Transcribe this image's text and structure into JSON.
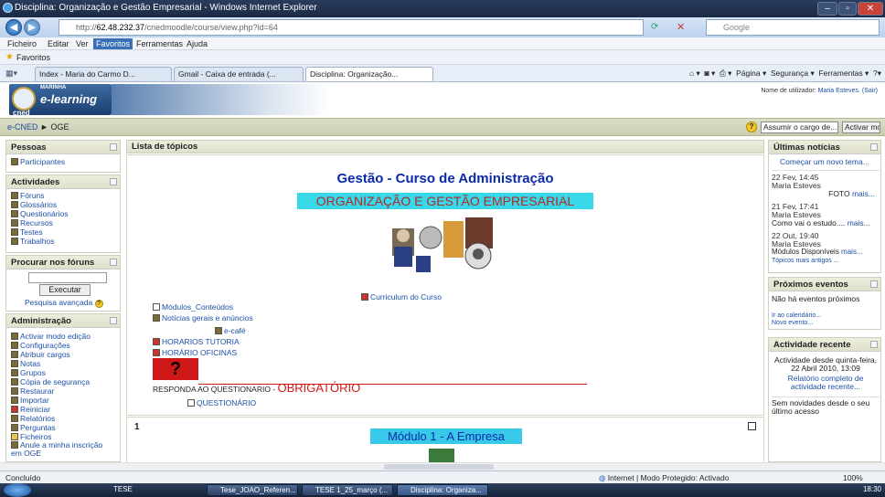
{
  "window": {
    "title": "Disciplina: Organização e Gestão Empresarial - Windows Internet Explorer"
  },
  "address": {
    "url_prefix": "http://",
    "url_host": "62.48.232.37",
    "url_path": "/cnedmoodle/course/view.php?id=64",
    "search_placeholder": "Google"
  },
  "menu": {
    "items": [
      "Ficheiro",
      "Editar",
      "Ver",
      "Favoritos",
      "Ferramentas",
      "Ajuda"
    ]
  },
  "favorites": {
    "label": "Favoritos"
  },
  "tabs": [
    "Index - Maria do Carmo D...",
    "Gmail - Caixa de entrada (...",
    "Disciplina: Organização..."
  ],
  "commandbar": {
    "page": "Página ▾",
    "security": "Segurança ▾",
    "tools": "Ferramentas ▾"
  },
  "header": {
    "logo_top": "MARINHA",
    "logo_main": "e-learning",
    "logo_bottom": "cned",
    "user_prefix": "Nome de utilizador:",
    "user_name": "Maria Esteves.",
    "logout": "(Sair)"
  },
  "navbar": {
    "home": "e-CNED",
    "sep": "►",
    "course": "OGE",
    "role_select": "Assumir o cargo de...",
    "edit_button": "Activar modo edição"
  },
  "left": {
    "pessoas": {
      "title": "Pessoas",
      "items": [
        "Participantes"
      ]
    },
    "actividades": {
      "title": "Actividades",
      "items": [
        "Fóruns",
        "Glossários",
        "Questionários",
        "Recursos",
        "Testes",
        "Trabalhos"
      ]
    },
    "procurar": {
      "title": "Procurar nos fóruns",
      "button": "Executar",
      "advanced": "Pesquisa avançada"
    },
    "admin": {
      "title": "Administração",
      "items": [
        "Activar modo edição",
        "Configurações",
        "Atribuir cargos",
        "Notas",
        "Grupos",
        "Cópia de segurança",
        "Restaurar",
        "Importar",
        "Reiniciar",
        "Relatórios",
        "Perguntas",
        "Ficheiros",
        "Anule a minha inscrição em OGE"
      ]
    }
  },
  "center": {
    "list_title": "Lista de tópicos",
    "course_title": "Gestão - Curso de Administração",
    "course_subtitle": "ORGANIZAÇÃO E GESTÃO EMPRESARIAL",
    "curriculum": "Curriculum do Curso",
    "modulos": "Módulos_Conteúdos",
    "noticias": "Notícias gerais e anúncios",
    "ecafe": "e-café",
    "horarios_tutoria": "HORARIOS TUTORIA",
    "horario_oficinas": "HORÁRIO OFICINAS",
    "responda": "RESPONDA AO QUESTIONARIO - ",
    "obrigatorio": "OBRIGATÓRIO",
    "questionario": "QUESTIONÁRIO",
    "section_number": "1",
    "modulo1": "Módulo 1 - A Empresa"
  },
  "right": {
    "noticias": {
      "title": "Últimas notícias",
      "new_topic": "Começar um novo tema...",
      "posts": [
        {
          "date": "22 Fev, 14:45",
          "author": "Maria Esteves",
          "text": "FOTO",
          "more": "mais..."
        },
        {
          "date": "21 Fev, 17:41",
          "author": "Maria Esteves",
          "text": "Como vai o estudo....",
          "more": "mais..."
        },
        {
          "date": "22 Out, 19:40",
          "author": "Maria Esteves",
          "text": "Módulos Disponíveis",
          "more": "mais..."
        }
      ],
      "older": "Tópicos mais antigos ..."
    },
    "eventos": {
      "title": "Próximos eventos",
      "none": "Não há eventos próximos",
      "calendar": "Ir ao calendário...",
      "new_event": "Novo evento..."
    },
    "recente": {
      "title": "Actividade recente",
      "since": "Actividade desde quinta-feira, 22 Abril 2010, 13:09",
      "report": "Relatório completo de actividade recente...",
      "none": "Sem novidades desde o seu último acesso"
    }
  },
  "statusbar": {
    "left": "Concluído",
    "zone": "Internet | Modo Protegido: Activado",
    "zoom": "100%"
  },
  "taskbar": {
    "items": [
      "TESE",
      "Tese_JOAO_Referen...",
      "TESE 1_25_março (...",
      "Disciplina: Organiza..."
    ],
    "clock": "18:30"
  }
}
